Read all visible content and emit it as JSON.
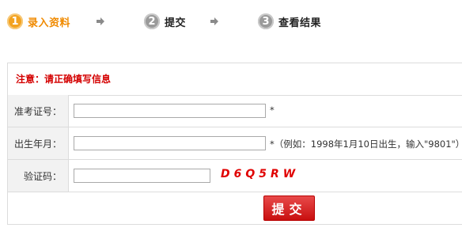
{
  "steps": [
    {
      "num": "1",
      "label": "录入资料"
    },
    {
      "num": "2",
      "label": "提交"
    },
    {
      "num": "3",
      "label": "查看结果"
    }
  ],
  "colors": {
    "accent": "#f08a00",
    "alert": "#d40000",
    "button": "#d61e1e"
  },
  "notice": "注意：请正确填写信息",
  "form": {
    "exam_id": {
      "label": "准考证号：",
      "value": "",
      "hint": "*"
    },
    "birth": {
      "label": "出生年月：",
      "value": "",
      "hint": "*（例如：1998年1月10日出生，输入\"9801\"）"
    },
    "captcha": {
      "label": "验证码：",
      "value": "",
      "code": "D6Q5RW"
    }
  },
  "submit_label": "提交"
}
